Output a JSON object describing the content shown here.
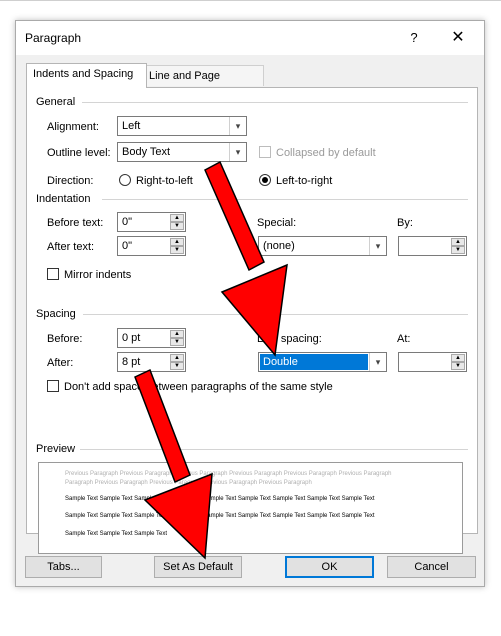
{
  "dialog": {
    "title": "Paragraph",
    "help": "?",
    "close": "✕"
  },
  "tabs": [
    {
      "label": "Indents and Spacing",
      "active": true
    },
    {
      "label": "Line and Page Breaks",
      "active": false
    }
  ],
  "general": {
    "header": "General",
    "alignment_label": "Alignment:",
    "alignment_value": "Left",
    "outline_label": "Outline level:",
    "outline_value": "Body Text",
    "collapsed_label": "Collapsed by default",
    "direction_label": "Direction:",
    "rtl_label": "Right-to-left",
    "ltr_label": "Left-to-right"
  },
  "indentation": {
    "header": "Indentation",
    "before_label": "Before text:",
    "before_value": "0\"",
    "after_label": "After text:",
    "after_value": "0\"",
    "special_label": "Special:",
    "special_value": "(none)",
    "by_label": "By:",
    "by_value": "",
    "mirror_label": "Mirror indents"
  },
  "spacing": {
    "header": "Spacing",
    "before_label": "Before:",
    "before_value": "0 pt",
    "after_label": "After:",
    "after_value": "8 pt",
    "line_label": "Line spacing:",
    "line_value": "Double",
    "at_label": "At:",
    "at_value": "",
    "dont_add_label": "Don't add space between paragraphs of the same style"
  },
  "preview": {
    "header": "Preview",
    "prev_line1": "Previous Paragraph Previous Paragraph Previous Paragraph Previous Paragraph Previous Paragraph Previous Paragraph",
    "prev_line2": "Paragraph Previous Paragraph Previous Paragraph Previous Paragraph Previous Paragraph",
    "sample1": "Sample Text Sample Text Sample Text Sample Text Sample Text Sample Text Sample Text Sample Text Sample Text",
    "sample2": "Sample Text Sample Text Sample Text Sample Text Sample Text Sample Text Sample Text Sample Text Sample Text",
    "sample3": "Sample Text Sample Text Sample Text"
  },
  "buttons": {
    "tabs": "Tabs...",
    "set_default": "Set As Default",
    "ok": "OK",
    "cancel": "Cancel"
  },
  "colors": {
    "accent": "#0078d7",
    "arrow": "#ff0000"
  },
  "icons": {
    "dropdown": "chevron-down-icon",
    "spin_up": "caret-up-icon",
    "spin_down": "caret-down-icon"
  }
}
